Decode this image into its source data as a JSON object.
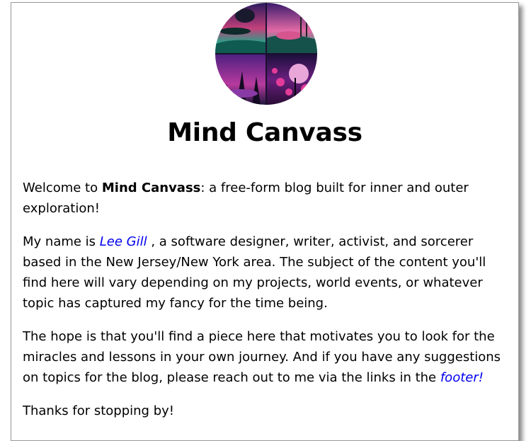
{
  "blog": {
    "title": "Mind Canvass",
    "intro": {
      "before": "Welcome to ",
      "strong": "Mind Canvass",
      "after": ": a free-form blog built for inner and outer exploration!"
    },
    "about": {
      "before": "My name is ",
      "link_label": "Lee Gill",
      "after": " , a software designer, writer, activist, and sorcerer based in the New Jersey/New York area. The subject of the content you'll find here will vary depending on my projects, world events, or whatever topic has captured my fancy for the time being."
    },
    "hope": {
      "before": "The hope is that you'll find a piece here that motivates you to look for the miracles and lessons in your own journey. And if you have any suggestions on topics for the blog, please reach out to me via the links in the ",
      "link_label": "footer!"
    },
    "thanks": "Thanks for stopping by!"
  },
  "colors": {
    "link": "#0000ee",
    "card_border": "#999999"
  },
  "icons": {
    "avatar": "surreal-collage-avatar"
  }
}
